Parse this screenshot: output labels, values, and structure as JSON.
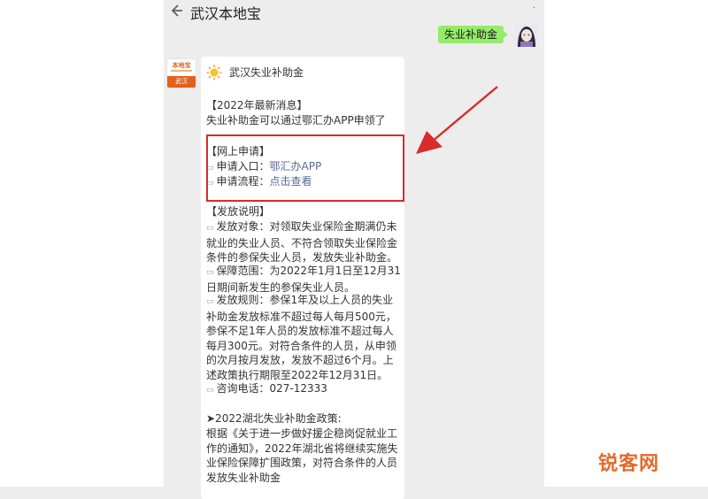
{
  "header": {
    "title": "武汉本地宝"
  },
  "outgoing_message": "失业补助金",
  "sender_avatar": {
    "line1": "本地宝",
    "line2": "武汉"
  },
  "card": {
    "brand_name": "武汉失业补助金",
    "news_heading": "【2022年最新消息】",
    "news_text": "失业补助金可以通过鄂汇办APP申领了",
    "online_heading": "【网上申请】",
    "entry_label": "申请入口：",
    "entry_link": "鄂汇办APP",
    "process_label": "申请流程：",
    "process_link": "点击查看",
    "release_heading": "【发放说明】",
    "target_text": "发放对象：对领取失业保险金期满仍未就业的失业人员、不符合领取失业保险金条件的参保失业人员，发放失业补助金。",
    "scope_text": "保障范围：为2022年1月1日至12月31日期间新发生的参保失业人员。",
    "rules_text": "发放规则：参保1年及以上人员的失业补助金发放标准不超过每人每月500元，参保不足1年人员的发放标准不超过每人每月300元。对符合条件的人员，从申领的次月按月发放，发放不超过6个月。上述政策执行期限至2022年12月31日。",
    "phone_text": "咨询电话：027-12333",
    "policy_heading": "➤2022湖北失业补助金政策:",
    "policy_text": "根据《关于进一步做好援企稳岗促就业工作的通知》，2022年湖北省将继续实施失业保险保障扩围政策，对符合条件的人员发放失业补助金"
  },
  "watermark": "锐客网",
  "colors": {
    "bubble_out": "#95ec69",
    "link": "#576b95",
    "annotation": "#d92b2b",
    "watermark": "#e56a2a"
  }
}
